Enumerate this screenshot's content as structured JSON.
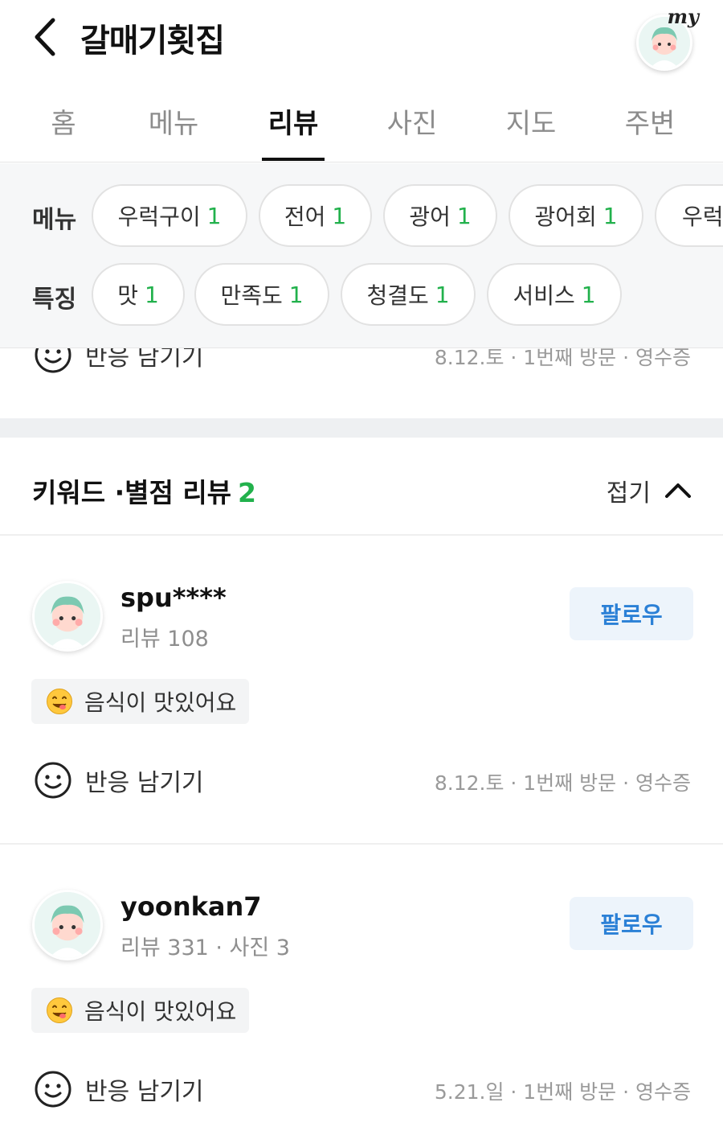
{
  "header": {
    "title": "갈매기횟집",
    "my_label": "my"
  },
  "tabs": [
    {
      "label": "홈"
    },
    {
      "label": "메뉴"
    },
    {
      "label": "리뷰"
    },
    {
      "label": "사진"
    },
    {
      "label": "지도"
    },
    {
      "label": "주변"
    }
  ],
  "active_tab": "리뷰",
  "filters": {
    "menu_label": "메뉴",
    "menu_chips": [
      {
        "label": "우럭구이",
        "count": "1"
      },
      {
        "label": "전어",
        "count": "1"
      },
      {
        "label": "광어",
        "count": "1"
      },
      {
        "label": "광어회",
        "count": "1"
      },
      {
        "label": "우럭"
      }
    ],
    "feature_label": "특징",
    "feature_chips": [
      {
        "label": "맛",
        "count": "1"
      },
      {
        "label": "만족도",
        "count": "1"
      },
      {
        "label": "청결도",
        "count": "1"
      },
      {
        "label": "서비스",
        "count": "1"
      }
    ]
  },
  "partial_row": {
    "react_label": "반응 남기기",
    "meta": "8.12.토 · 1번째 방문 · 영수증"
  },
  "section": {
    "title": "키워드 ·별점 리뷰",
    "count": "2",
    "fold_label": "접기"
  },
  "reviews": [
    {
      "username": "spu****",
      "stats": "리뷰 108",
      "follow_label": "팔로우",
      "keyword": "음식이 맛있어요",
      "react_label": "반응 남기기",
      "meta": "8.12.토 · 1번째 방문 · 영수증"
    },
    {
      "username": "yoonkan7",
      "stats": "리뷰 331 · 사진 3",
      "follow_label": "팔로우",
      "keyword": "음식이 맛있어요",
      "react_label": "반응 남기기",
      "meta": "5.21.일 · 1번째 방문 · 영수증"
    }
  ],
  "colors": {
    "accent_green": "#22b14c",
    "follow_blue": "#2b80d6"
  },
  "icons": {
    "back": "chevron-left-icon",
    "fold": "chevron-up-icon",
    "react": "smile-icon",
    "keyword": "yum-emoji-icon"
  }
}
